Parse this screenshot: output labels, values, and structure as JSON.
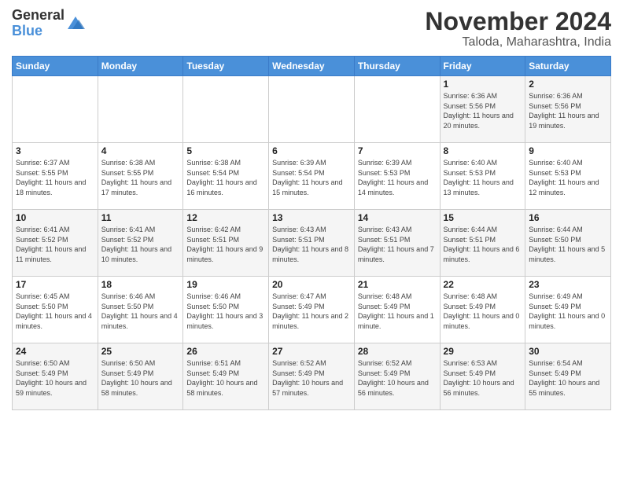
{
  "logo": {
    "general": "General",
    "blue": "Blue"
  },
  "header": {
    "month": "November 2024",
    "location": "Taloda, Maharashtra, India"
  },
  "days_of_week": [
    "Sunday",
    "Monday",
    "Tuesday",
    "Wednesday",
    "Thursday",
    "Friday",
    "Saturday"
  ],
  "weeks": [
    [
      {
        "day": "",
        "info": ""
      },
      {
        "day": "",
        "info": ""
      },
      {
        "day": "",
        "info": ""
      },
      {
        "day": "",
        "info": ""
      },
      {
        "day": "",
        "info": ""
      },
      {
        "day": "1",
        "info": "Sunrise: 6:36 AM\nSunset: 5:56 PM\nDaylight: 11 hours and 20 minutes."
      },
      {
        "day": "2",
        "info": "Sunrise: 6:36 AM\nSunset: 5:56 PM\nDaylight: 11 hours and 19 minutes."
      }
    ],
    [
      {
        "day": "3",
        "info": "Sunrise: 6:37 AM\nSunset: 5:55 PM\nDaylight: 11 hours and 18 minutes."
      },
      {
        "day": "4",
        "info": "Sunrise: 6:38 AM\nSunset: 5:55 PM\nDaylight: 11 hours and 17 minutes."
      },
      {
        "day": "5",
        "info": "Sunrise: 6:38 AM\nSunset: 5:54 PM\nDaylight: 11 hours and 16 minutes."
      },
      {
        "day": "6",
        "info": "Sunrise: 6:39 AM\nSunset: 5:54 PM\nDaylight: 11 hours and 15 minutes."
      },
      {
        "day": "7",
        "info": "Sunrise: 6:39 AM\nSunset: 5:53 PM\nDaylight: 11 hours and 14 minutes."
      },
      {
        "day": "8",
        "info": "Sunrise: 6:40 AM\nSunset: 5:53 PM\nDaylight: 11 hours and 13 minutes."
      },
      {
        "day": "9",
        "info": "Sunrise: 6:40 AM\nSunset: 5:53 PM\nDaylight: 11 hours and 12 minutes."
      }
    ],
    [
      {
        "day": "10",
        "info": "Sunrise: 6:41 AM\nSunset: 5:52 PM\nDaylight: 11 hours and 11 minutes."
      },
      {
        "day": "11",
        "info": "Sunrise: 6:41 AM\nSunset: 5:52 PM\nDaylight: 11 hours and 10 minutes."
      },
      {
        "day": "12",
        "info": "Sunrise: 6:42 AM\nSunset: 5:51 PM\nDaylight: 11 hours and 9 minutes."
      },
      {
        "day": "13",
        "info": "Sunrise: 6:43 AM\nSunset: 5:51 PM\nDaylight: 11 hours and 8 minutes."
      },
      {
        "day": "14",
        "info": "Sunrise: 6:43 AM\nSunset: 5:51 PM\nDaylight: 11 hours and 7 minutes."
      },
      {
        "day": "15",
        "info": "Sunrise: 6:44 AM\nSunset: 5:51 PM\nDaylight: 11 hours and 6 minutes."
      },
      {
        "day": "16",
        "info": "Sunrise: 6:44 AM\nSunset: 5:50 PM\nDaylight: 11 hours and 5 minutes."
      }
    ],
    [
      {
        "day": "17",
        "info": "Sunrise: 6:45 AM\nSunset: 5:50 PM\nDaylight: 11 hours and 4 minutes."
      },
      {
        "day": "18",
        "info": "Sunrise: 6:46 AM\nSunset: 5:50 PM\nDaylight: 11 hours and 4 minutes."
      },
      {
        "day": "19",
        "info": "Sunrise: 6:46 AM\nSunset: 5:50 PM\nDaylight: 11 hours and 3 minutes."
      },
      {
        "day": "20",
        "info": "Sunrise: 6:47 AM\nSunset: 5:49 PM\nDaylight: 11 hours and 2 minutes."
      },
      {
        "day": "21",
        "info": "Sunrise: 6:48 AM\nSunset: 5:49 PM\nDaylight: 11 hours and 1 minute."
      },
      {
        "day": "22",
        "info": "Sunrise: 6:48 AM\nSunset: 5:49 PM\nDaylight: 11 hours and 0 minutes."
      },
      {
        "day": "23",
        "info": "Sunrise: 6:49 AM\nSunset: 5:49 PM\nDaylight: 11 hours and 0 minutes."
      }
    ],
    [
      {
        "day": "24",
        "info": "Sunrise: 6:50 AM\nSunset: 5:49 PM\nDaylight: 10 hours and 59 minutes."
      },
      {
        "day": "25",
        "info": "Sunrise: 6:50 AM\nSunset: 5:49 PM\nDaylight: 10 hours and 58 minutes."
      },
      {
        "day": "26",
        "info": "Sunrise: 6:51 AM\nSunset: 5:49 PM\nDaylight: 10 hours and 58 minutes."
      },
      {
        "day": "27",
        "info": "Sunrise: 6:52 AM\nSunset: 5:49 PM\nDaylight: 10 hours and 57 minutes."
      },
      {
        "day": "28",
        "info": "Sunrise: 6:52 AM\nSunset: 5:49 PM\nDaylight: 10 hours and 56 minutes."
      },
      {
        "day": "29",
        "info": "Sunrise: 6:53 AM\nSunset: 5:49 PM\nDaylight: 10 hours and 56 minutes."
      },
      {
        "day": "30",
        "info": "Sunrise: 6:54 AM\nSunset: 5:49 PM\nDaylight: 10 hours and 55 minutes."
      }
    ]
  ]
}
